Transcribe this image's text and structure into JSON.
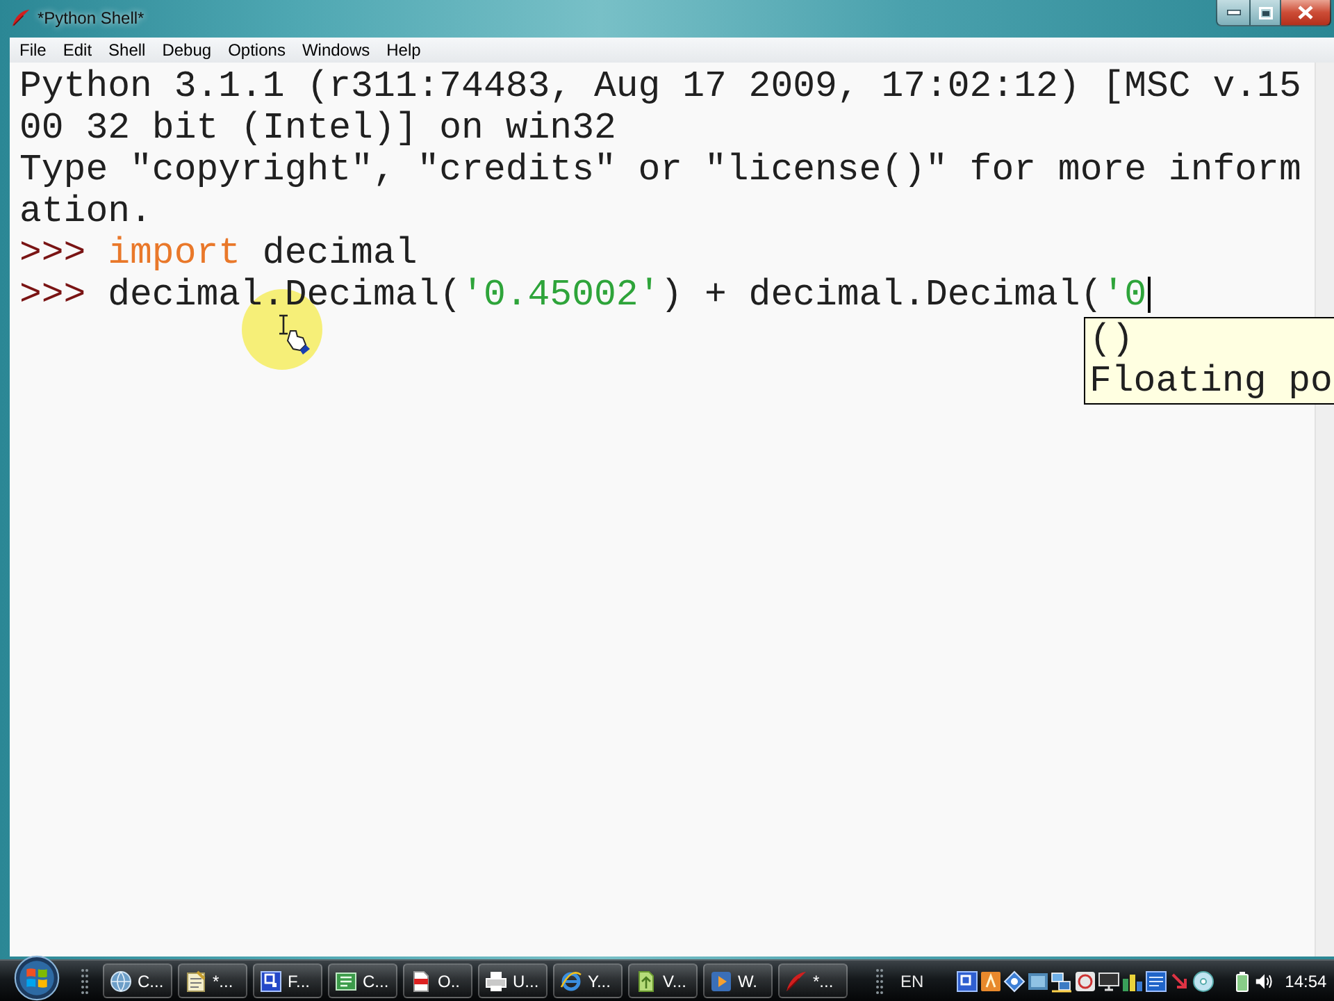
{
  "window": {
    "title": "*Python Shell*"
  },
  "menu": [
    "File",
    "Edit",
    "Shell",
    "Debug",
    "Options",
    "Windows",
    "Help"
  ],
  "shell": {
    "lines": [
      {
        "kind": "output",
        "cursor": false,
        "text": "Python 3.1.1 (r311:74483, Aug 17 2009, 17:02:12) [MSC v.1500 32 bit (Intel)] on win32"
      },
      {
        "kind": "output",
        "cursor": false,
        "text": "Type \"copyright\", \"credits\" or \"license()\" for more information."
      },
      {
        "kind": "input",
        "cursor": false,
        "prompt": ">>>",
        "tokens": [
          {
            "kind": "keyword",
            "text": "import"
          },
          {
            "kind": "plain",
            "text": " decimal"
          }
        ]
      },
      {
        "kind": "input",
        "cursor": true,
        "prompt": ">>>",
        "tokens": [
          {
            "kind": "plain",
            "text": "decimal.Decimal("
          },
          {
            "kind": "string",
            "text": "'0.45002'"
          },
          {
            "kind": "plain",
            "text": ") + decimal.Decimal("
          },
          {
            "kind": "string",
            "text": "'0"
          }
        ]
      }
    ],
    "calltip": [
      "()",
      "Floating po"
    ]
  },
  "taskbar": {
    "tasks": [
      "C...",
      "*...",
      "F...",
      "C...",
      "O..",
      "U...",
      "Y...",
      "V...",
      "W.",
      "*..."
    ],
    "language": "EN",
    "clock": "14:54"
  }
}
